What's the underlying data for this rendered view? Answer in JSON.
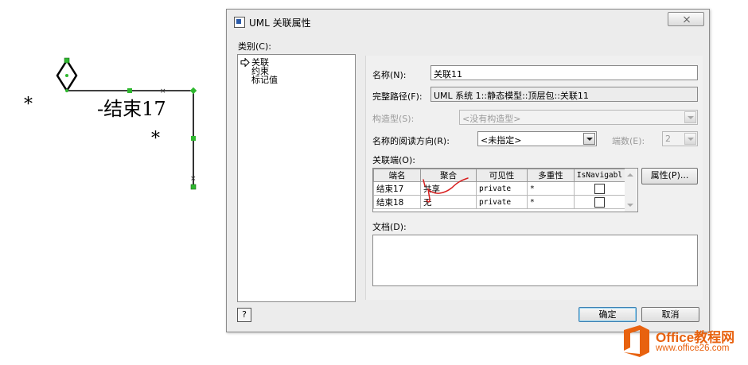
{
  "diagram": {
    "multiplicity_left": "*",
    "end_label": "-结束17",
    "multiplicity_right": "*"
  },
  "window": {
    "title": "UML 关联属性",
    "icon": "uml-dialog-icon"
  },
  "category": {
    "label": "类别(C):",
    "items": [
      "关联",
      "约束",
      "标记值"
    ]
  },
  "fields": {
    "name_label": "名称(N):",
    "name_value": "关联11",
    "fullpath_label": "完整路径(F):",
    "fullpath_value": "UML 系统 1::静态模型::顶层包::关联11",
    "stereotype_label": "构造型(S):",
    "stereotype_value": "<没有构造型>",
    "read_direction_label": "名称的阅读方向(R):",
    "read_direction_value": "<未指定>",
    "end_count_label": "端数(E):",
    "end_count_value": "2"
  },
  "association_ends": {
    "label": "关联端(O):",
    "columns": [
      "端名",
      "聚合",
      "可见性",
      "多重性",
      "IsNavigabl"
    ],
    "rows": [
      {
        "name": "结束17",
        "aggregation": "共享",
        "visibility": "private",
        "multiplicity": "*"
      },
      {
        "name": "结束18",
        "aggregation": "无",
        "visibility": "private",
        "multiplicity": "*"
      }
    ],
    "properties_button": "属性(P)..."
  },
  "documentation": {
    "label": "文档(D):"
  },
  "buttons": {
    "help": "?",
    "ok": "确定",
    "cancel": "取消"
  },
  "watermark": {
    "brand": "Office教程网",
    "url": "www.office26.com"
  },
  "colors": {
    "selection_green": "#2eb82e",
    "annotation_red": "#d81e1e",
    "brand_orange": "#e8620f"
  }
}
